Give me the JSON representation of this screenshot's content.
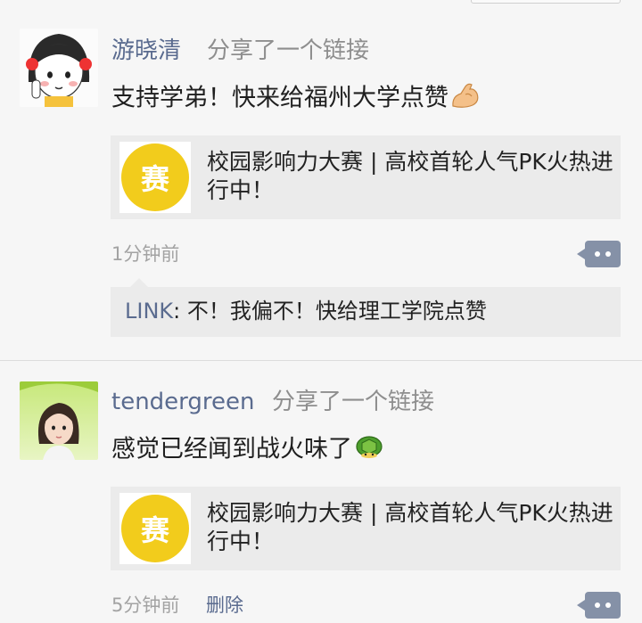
{
  "posts": [
    {
      "username": "游晓清",
      "action": "分享了一个链接",
      "content": "支持学弟！快来给福州大学点赞",
      "content_emoji": "flexed-biceps-icon",
      "link": {
        "thumb_char": "赛",
        "title": "校园影响力大赛 | 高校首轮人气PK火热进行中！"
      },
      "time": "1分钟前",
      "reply": {
        "author": "LINK",
        "separator": ": ",
        "text": "不！我偏不！快给理工学院点赞"
      }
    },
    {
      "username": "tendergreen",
      "action": "分享了一个链接",
      "content": "感觉已经闻到战火味了",
      "content_emoji": "turtle-icon",
      "link": {
        "thumb_char": "赛",
        "title": "校园影响力大赛 | 高校首轮人气PK火热进行中！"
      },
      "time": "5分钟前",
      "delete_label": "删除"
    }
  ],
  "colors": {
    "username": "#5a6b8f",
    "meta": "#a3a3a3",
    "card_bg": "#ebebeb",
    "thumb_yellow": "#f2cc1c",
    "comment_button": "#8591a7"
  }
}
